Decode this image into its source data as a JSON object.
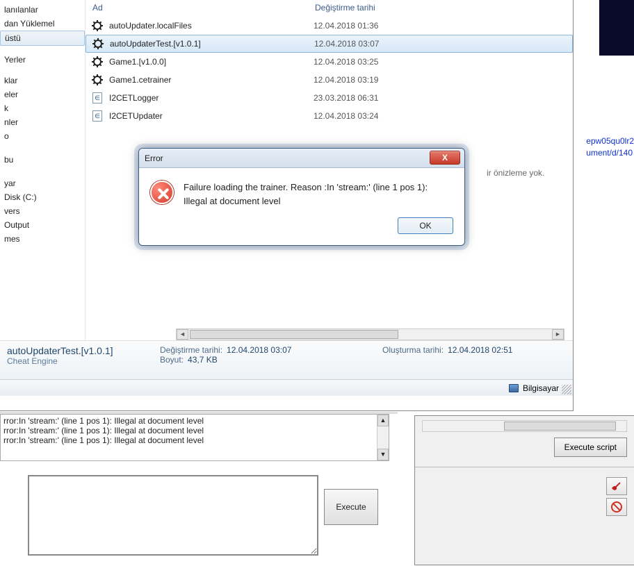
{
  "sidebar": {
    "items": [
      "lanılanlar",
      "dan Yüklemel",
      "üstü",
      "Yerler",
      "klar",
      "eler",
      "k",
      "nler",
      "o",
      "bu",
      "yar",
      "Disk (C:)",
      "vers",
      "Output",
      "mes"
    ],
    "activeIndex": 2
  },
  "columns": {
    "name": "Ad",
    "date": "Değiştirme tarihi"
  },
  "files": [
    {
      "icon": "ce",
      "name": "autoUpdater.localFiles",
      "date": "12.04.2018 01:36"
    },
    {
      "icon": "ce",
      "name": "autoUpdaterTest.[v1.0.1]",
      "date": "12.04.2018 03:07",
      "selected": true
    },
    {
      "icon": "ce",
      "name": "Game1.[v1.0.0]",
      "date": "12.04.2018 03:25"
    },
    {
      "icon": "ce",
      "name": "Game1.cetrainer",
      "date": "12.04.2018 03:19"
    },
    {
      "icon": "doc",
      "name": "I2CETLogger",
      "date": "23.03.2018 06:31"
    },
    {
      "icon": "doc",
      "name": "I2CETUpdater",
      "date": "12.04.2018 03:24"
    }
  ],
  "preview": {
    "text": "ir önizleme yok."
  },
  "details": {
    "filename": "autoUpdaterTest.[v1.0.1]",
    "filetype": "Cheat Engine",
    "modLabel": "Değiştirme tarihi:",
    "modVal": "12.04.2018 03:07",
    "sizeLabel": "Boyut:",
    "sizeVal": "43,7 KB",
    "createLabel": "Oluşturma tarihi:",
    "createVal": "12.04.2018 02:51"
  },
  "status": {
    "computer": "Bilgisayar"
  },
  "dialog": {
    "title": "Error",
    "message": "Failure loading the trainer. Reason :In 'stream:' (line 1 pos 1): Illegal at document level",
    "ok": "OK",
    "close": "X"
  },
  "console": {
    "lines": [
      "rror:In 'stream:' (line 1 pos 1): Illegal at document level",
      "rror:In 'stream:' (line 1 pos 1): Illegal at document level",
      "rror:In 'stream:' (line 1 pos 1): Illegal at document level"
    ],
    "execute": "Execute"
  },
  "rpanel": {
    "executeScript": "Execute script"
  },
  "code": {
    "l1": "epw05qu0lr2",
    "l2": "ument/d/140"
  }
}
